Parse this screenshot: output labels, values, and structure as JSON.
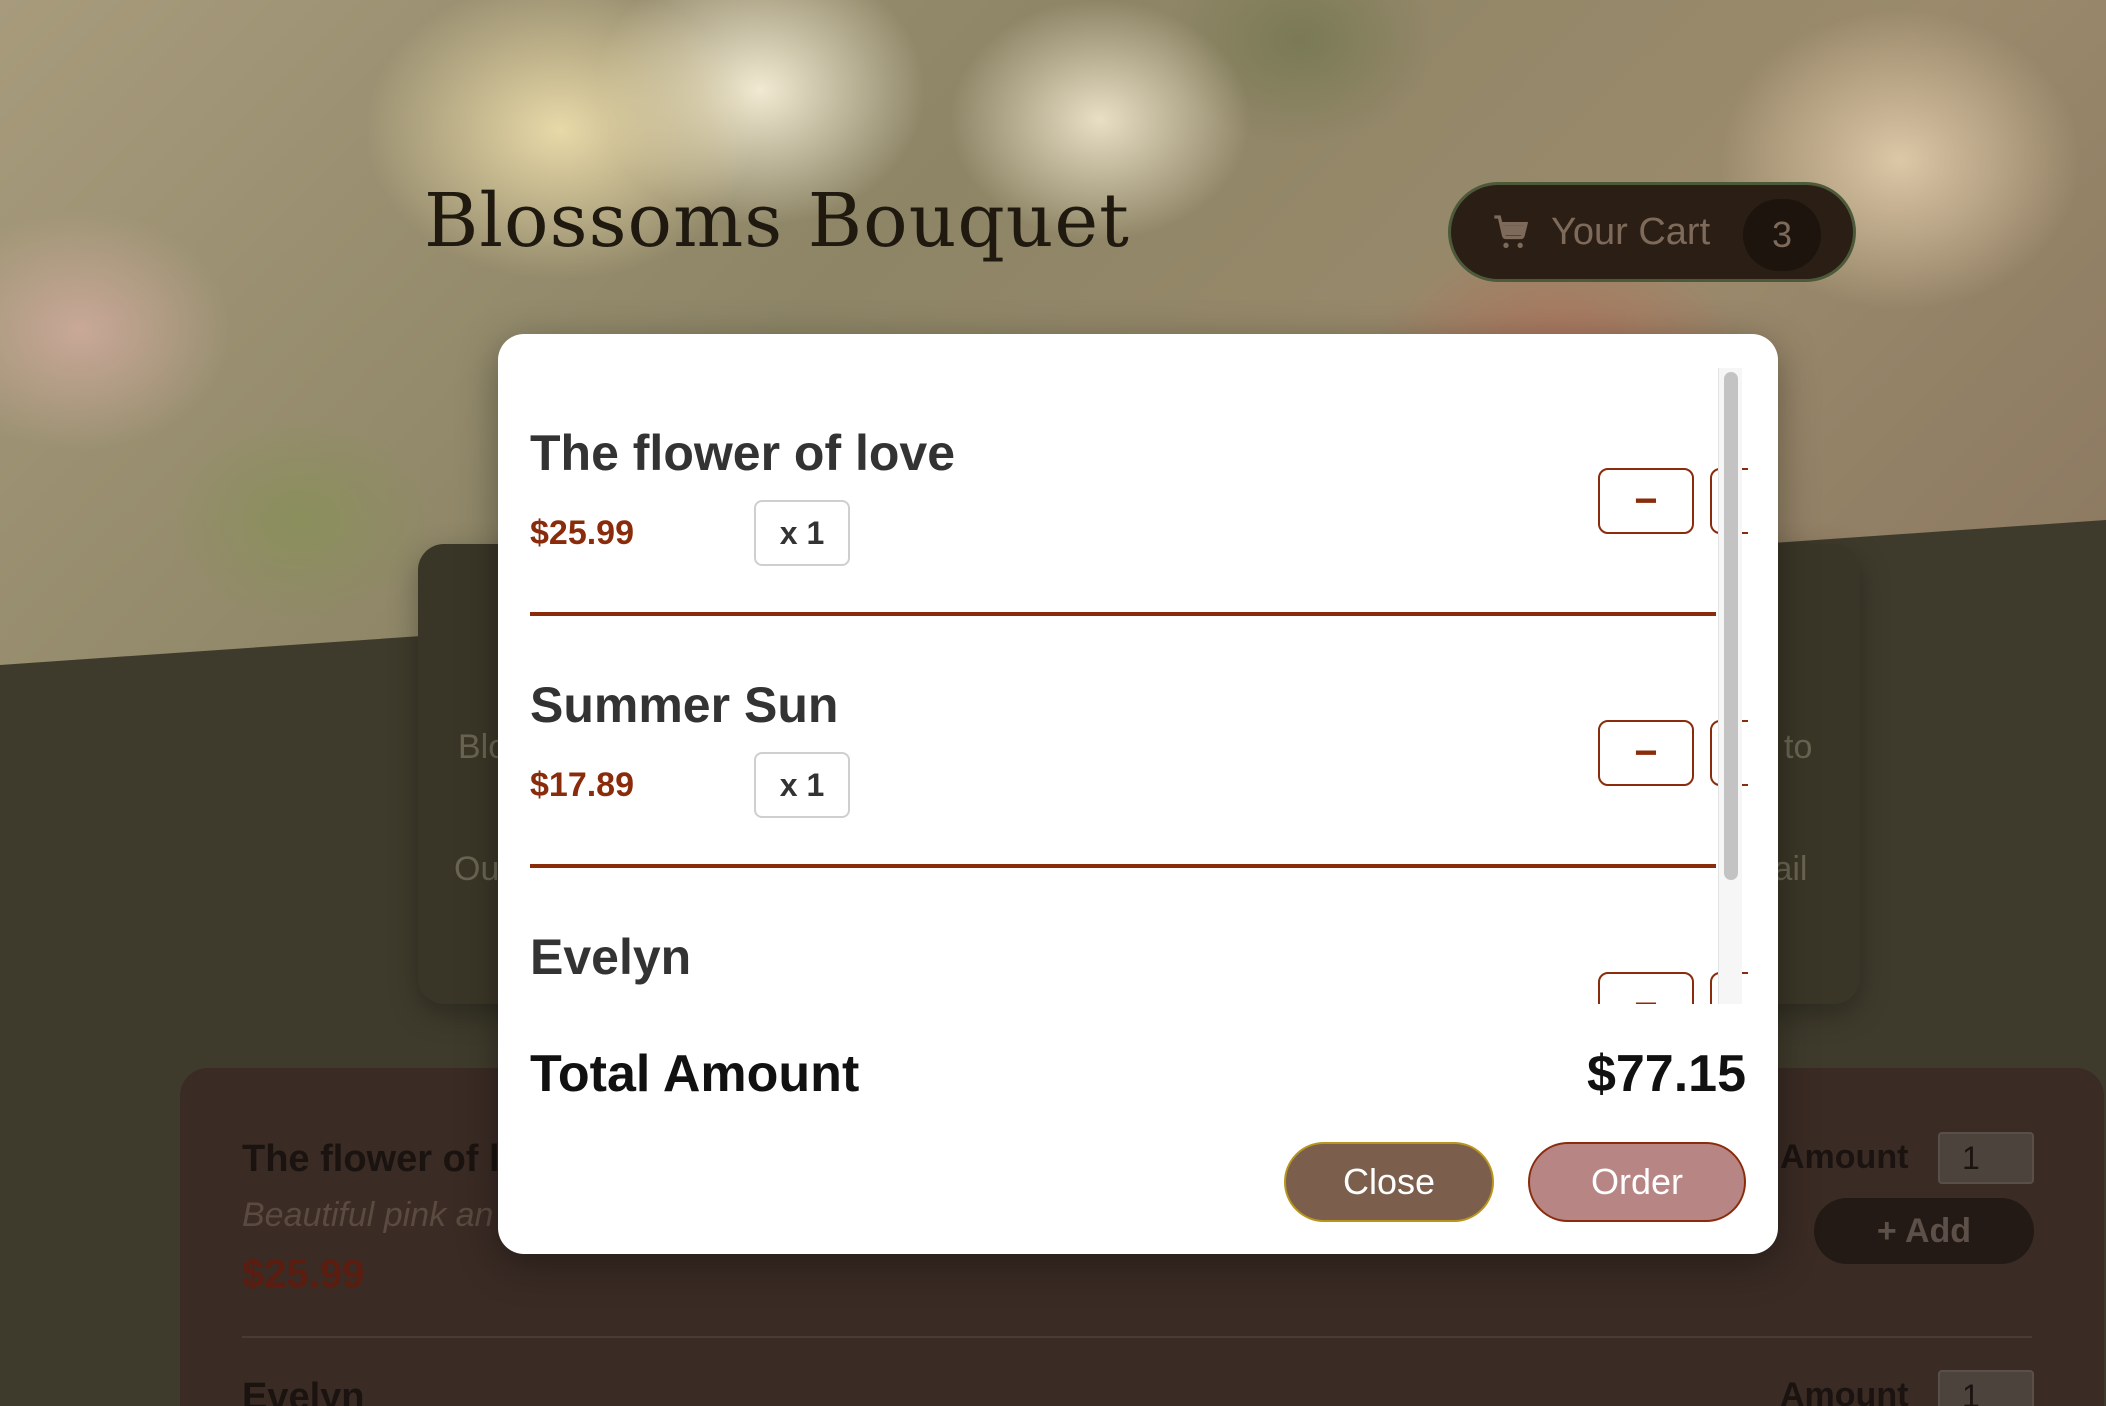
{
  "header": {
    "brand": "Blossoms Bouquet",
    "cart_label": "Your Cart",
    "cart_count": "3"
  },
  "about": {
    "line1_left": "Blo",
    "line1_right": "to",
    "line2_left": "Ou",
    "line2_right": "tail"
  },
  "products": [
    {
      "name": "The flower of l",
      "description": "Beautiful pink an",
      "price": "$25.99",
      "amount_label": "Amount",
      "amount_value": "1",
      "add_label": "+ Add"
    },
    {
      "name": "Evelyn",
      "amount_label": "Amount",
      "amount_value": "1"
    }
  ],
  "modal": {
    "items": [
      {
        "name": "The flower of love",
        "price": "$25.99",
        "qty": "x 1",
        "minus": "−",
        "plus": "+"
      },
      {
        "name": "Summer Sun",
        "price": "$17.89",
        "qty": "x 1",
        "minus": "−",
        "plus": "+"
      },
      {
        "name": "Evelyn",
        "price": "",
        "qty": "",
        "minus": "−",
        "plus": "+"
      }
    ],
    "total_label": "Total Amount",
    "total_value": "$77.15",
    "close_label": "Close",
    "order_label": "Order"
  },
  "colors": {
    "accent": "#8a2c0c",
    "close_button": "#7b5e4c",
    "order_button": "#b88585"
  },
  "icons": {
    "cart": "shopping-cart-icon"
  }
}
